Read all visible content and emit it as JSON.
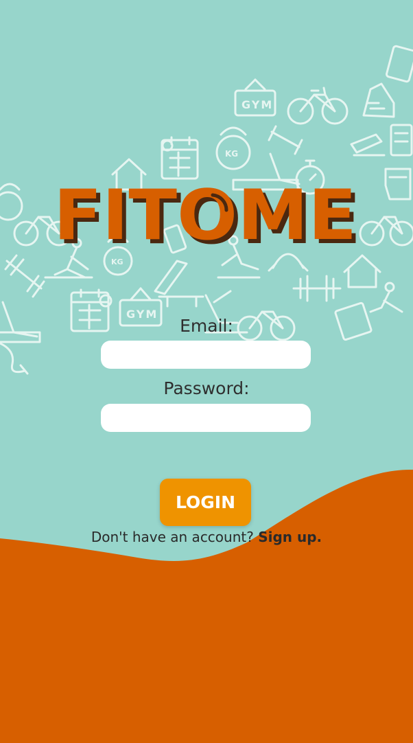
{
  "app": {
    "logo_text": "FITOME"
  },
  "form": {
    "email_label": "Email:",
    "email_value": "",
    "password_label": "Password:",
    "password_value": "",
    "login_label": "LOGIN",
    "signup_prompt": "Don't have an account?",
    "signup_link": "Sign up."
  },
  "theme": {
    "background": "#97d5cb",
    "accent": "#d75f00",
    "button": "#ef9300",
    "icon_outline": "#e6f5f1"
  }
}
